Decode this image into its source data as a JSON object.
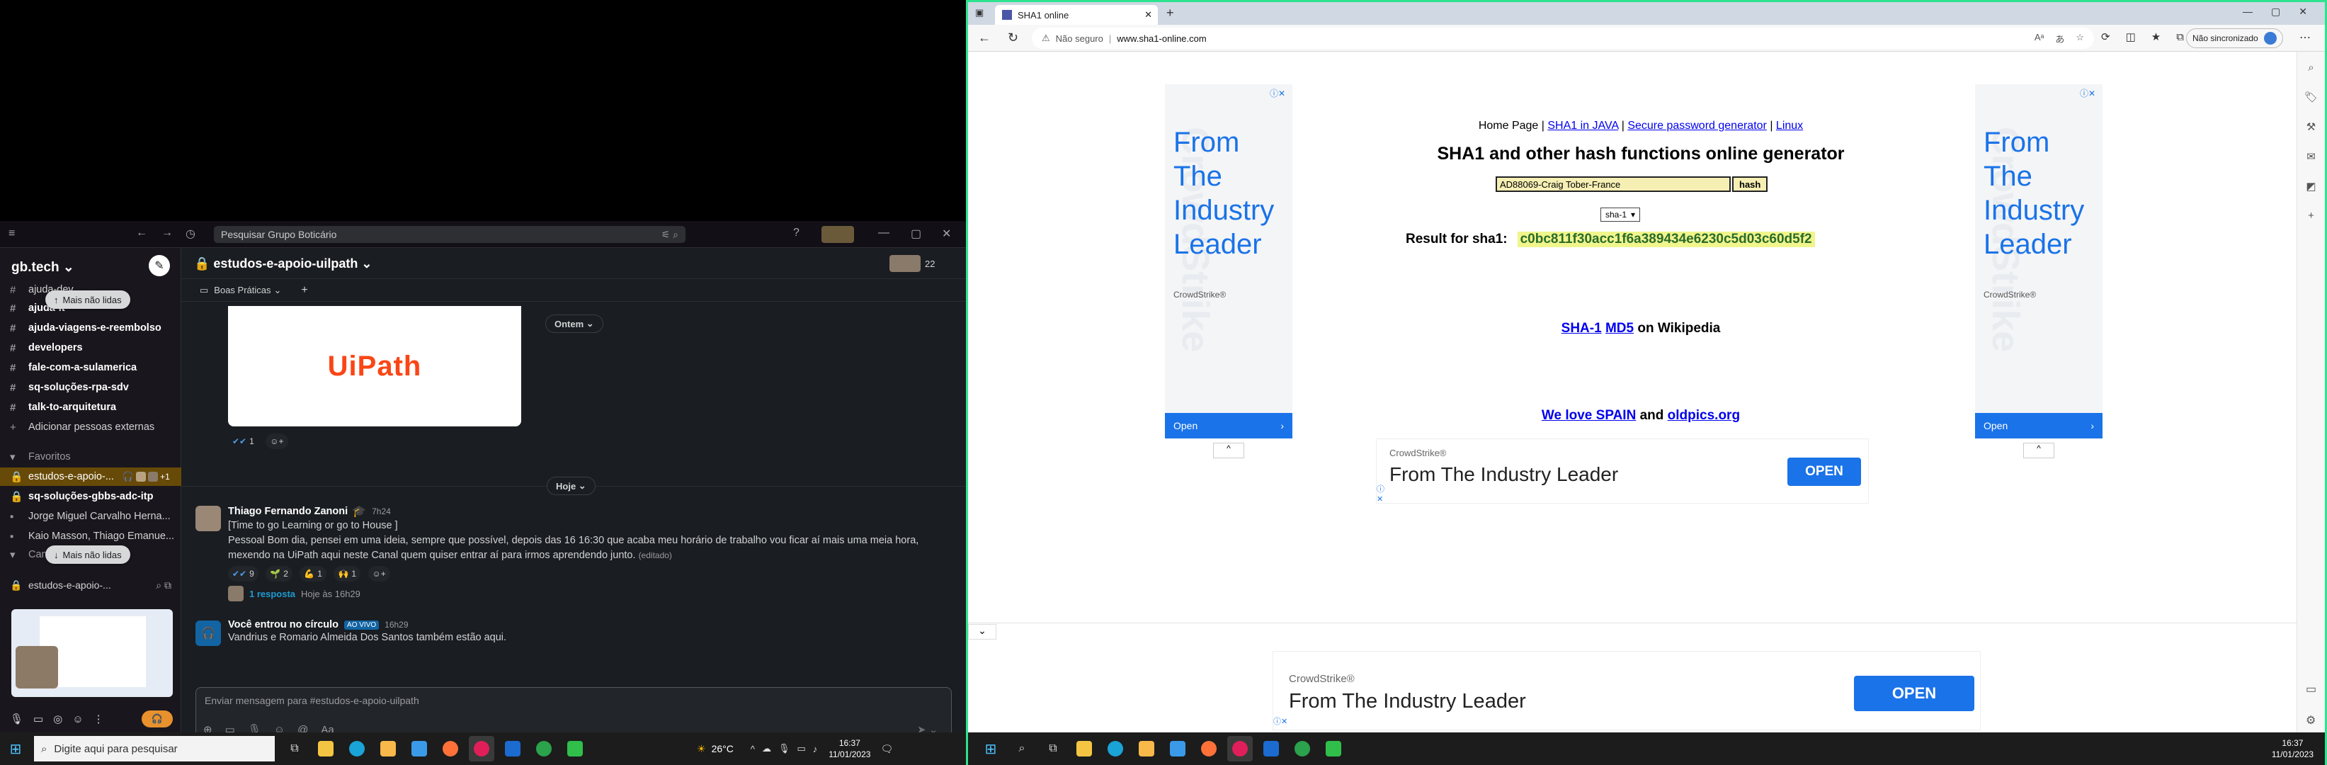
{
  "slack": {
    "search_placeholder": "Pesquisar Grupo Boticário",
    "workspace": "gb.tech",
    "pill_top": "Mais não lidas",
    "pill_bottom": "Mais não lidas",
    "channels": [
      {
        "label": "ajuda-dev",
        "bold": false
      },
      {
        "label": "ajuda-it",
        "bold": true
      },
      {
        "label": "ajuda-viagens-e-reembolso",
        "bold": true
      },
      {
        "label": "developers",
        "bold": true
      },
      {
        "label": "fale-com-a-sulamerica",
        "bold": true
      },
      {
        "label": "sq-soluções-rpa-sdv",
        "bold": true
      },
      {
        "label": "talk-to-arquitetura",
        "bold": true
      }
    ],
    "add_people": "Adicionar pessoas externas",
    "favorites_header": "Favoritos",
    "favorites": [
      {
        "label": "estudos-e-apoio-...",
        "extra": "+1"
      },
      {
        "label": "sq-soluções-gbbs-adc-itp"
      },
      {
        "label": "Jorge Miguel Carvalho Herna..."
      },
      {
        "label": "Kaio Masson, Thiago Emanue..."
      }
    ],
    "channels_header": "Canais",
    "huddle_channel": "estudos-e-apoio-...",
    "channel_title": "estudos-e-apoio-uilpath",
    "member_count": "22",
    "bookmark": "Boas Práticas",
    "date_top": "Ontem",
    "date_today": "Hoje",
    "uipath_logo": "UiPath",
    "first_reaction_count": "1",
    "message": {
      "author": "Thiago Fernando Zanoni",
      "time": "7h24",
      "line1": "[Time to go Learning or go to House ]",
      "line2": "Pessoal Bom dia, pensei em uma ideia, sempre que possível, depois das 16 16:30 que acaba meu horário de trabalho vou ficar aí mais uma meia hora,",
      "line3": "mexendo na UiPath aqui neste Canal quem quiser entrar aí para irmos aprendendo junto.",
      "edited": "(editado)",
      "reactions": [
        "9",
        "2",
        "1",
        "1"
      ],
      "thread_replies": "1 resposta",
      "thread_time": "Hoje às 16h29"
    },
    "huddle_msg": {
      "author": "Você entrou no círculo",
      "badge": "AO VIVO",
      "time": "16h29",
      "text": "Vandrius e Romario Almeida Dos Santos também estão aqui."
    },
    "composer_placeholder": "Enviar mensagem para #estudos-e-apoio-uilpath"
  },
  "taskbar_left": {
    "search_placeholder": "Digite aqui para pesquisar",
    "temperature": "26°C",
    "time": "16:37",
    "date": "11/01/2023"
  },
  "taskbar_right": {
    "time": "16:37",
    "date": "11/01/2023"
  },
  "edge": {
    "tab_title": "SHA1 online",
    "not_secure": "Não seguro",
    "url": "www.sha1-online.com",
    "sync": "Não sincronizado"
  },
  "page": {
    "nav": {
      "home": "Home Page",
      "java": "SHA1 in JAVA",
      "secure": "Secure password generator",
      "linux": "Linux"
    },
    "heading": "SHA1 and other hash functions online generator",
    "input_value": "AD88069-Craig Tober-France",
    "hash_button": "hash",
    "algo_selected": "sha-1",
    "result_label": "Result for sha1:",
    "result_value": "c0bc811f30acc1f6a389434e6230c5d03c60d5f2",
    "wiki_sha": "SHA-1",
    "wiki_md5": "MD5",
    "wiki_suffix": "on Wikipedia",
    "spain": "We love SPAIN",
    "and": "and",
    "oldpics": "oldpics.org"
  },
  "ads": {
    "side_text": [
      "From",
      "The",
      "Industry",
      "Leader"
    ],
    "brand": "CrowdStrike®",
    "watermark": "CrowdStrike",
    "open": "Open",
    "banner_headline": "From The Industry Leader",
    "banner_cta": "OPEN"
  },
  "colors": {
    "slack_sidebar": "#19171d",
    "slack_active": "#684a08",
    "monitor_border": "#2ee38e",
    "ad_blue": "#1a73e8",
    "result_bg": "#f0f58c"
  }
}
